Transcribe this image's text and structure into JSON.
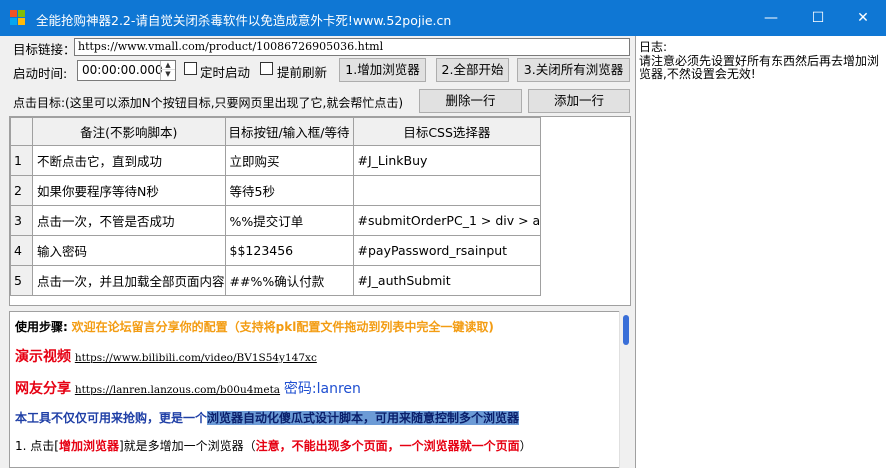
{
  "window": {
    "title": "全能抢购神器2.2-请自觉关闭杀毒软件以免造成意外卡死!www.52pojie.cn",
    "minimize_glyph": "—",
    "maximize_glyph": "☐",
    "close_glyph": "✕",
    "icon_colors": [
      "#f35325",
      "#81bc06",
      "#05a6f0",
      "#ffba08"
    ]
  },
  "colors": {
    "titlebar": "#0f77d4",
    "accent_orange": "#f39c12",
    "accent_red": "#e60012",
    "highlight": "#6c9bd6"
  },
  "form": {
    "target_label": "目标链接：",
    "target_url": "https://www.vmall.com/product/10086726905036.html",
    "start_time_label": "启动时间:",
    "start_time_value": "00:00:00.000",
    "timed_start_label": "定时启动",
    "timed_start_checked": false,
    "pre_refresh_label": "提前刷新",
    "pre_refresh_checked": false,
    "click_targets_hint": "点击目标:(这里可以添加N个按钮目标,只要网页里出现了它,就会帮忙点击)"
  },
  "buttons": {
    "add_browser": "1.增加浏览器",
    "start_all": "2.全部开始",
    "close_all": "3.关闭所有浏览器",
    "delete_row": "删除一行",
    "add_row": "添加一行"
  },
  "table": {
    "columns": [
      "备注(不影响脚本)",
      "目标按钮/输入框/等待",
      "目标CSS选择器"
    ],
    "rows": [
      {
        "n": "1",
        "note": "不断点击它，直到成功",
        "target": "立即购买",
        "selector": "#J_LinkBuy"
      },
      {
        "n": "2",
        "note": "如果你要程序等待N秒",
        "target": "等待5秒",
        "selector": ""
      },
      {
        "n": "3",
        "note": "点击一次，不管是否成功",
        "target": "%%提交订单",
        "selector": "#submitOrderPC_1 > div > a"
      },
      {
        "n": "4",
        "note": "输入密码",
        "target": "$$123456",
        "selector": "#payPassword_rsainput"
      },
      {
        "n": "5",
        "note": "点击一次，并且加载全部页面内容",
        "target": "##%%确认付款",
        "selector": "#J_authSubmit"
      }
    ]
  },
  "log": {
    "title": "日志:",
    "text": "请注意必须先设置好所有东西然后再去增加浏览器,不然设置会无效!"
  },
  "help": {
    "steps_label": "使用步骤:",
    "steps_text": "欢迎在论坛留言分享你的配置（支持将pkl配置文件拖动到列表中完全一键读取)",
    "video_label": "演示视频",
    "video_link": "https://www.bilibili.com/video/BV1S54y147xc",
    "share_label": "网友分享",
    "share_link": "https://lanren.lanzous.com/b00u4meta",
    "share_password": "密码:lanren",
    "desc_prefix": "本工具不仅仅可用来抢购，更是一个",
    "desc_highlight": "浏览器自动化傻瓜式设计脚本，可用来随意控制多个浏览器",
    "step1_prefix": "1. 点击[",
    "step1_btn": "增加浏览器",
    "step1_mid": "]就是多增加一个浏览器（",
    "step1_warn": "注意，不能出现多个页面，一个浏览器就一个页面",
    "step1_suffix": "）"
  }
}
